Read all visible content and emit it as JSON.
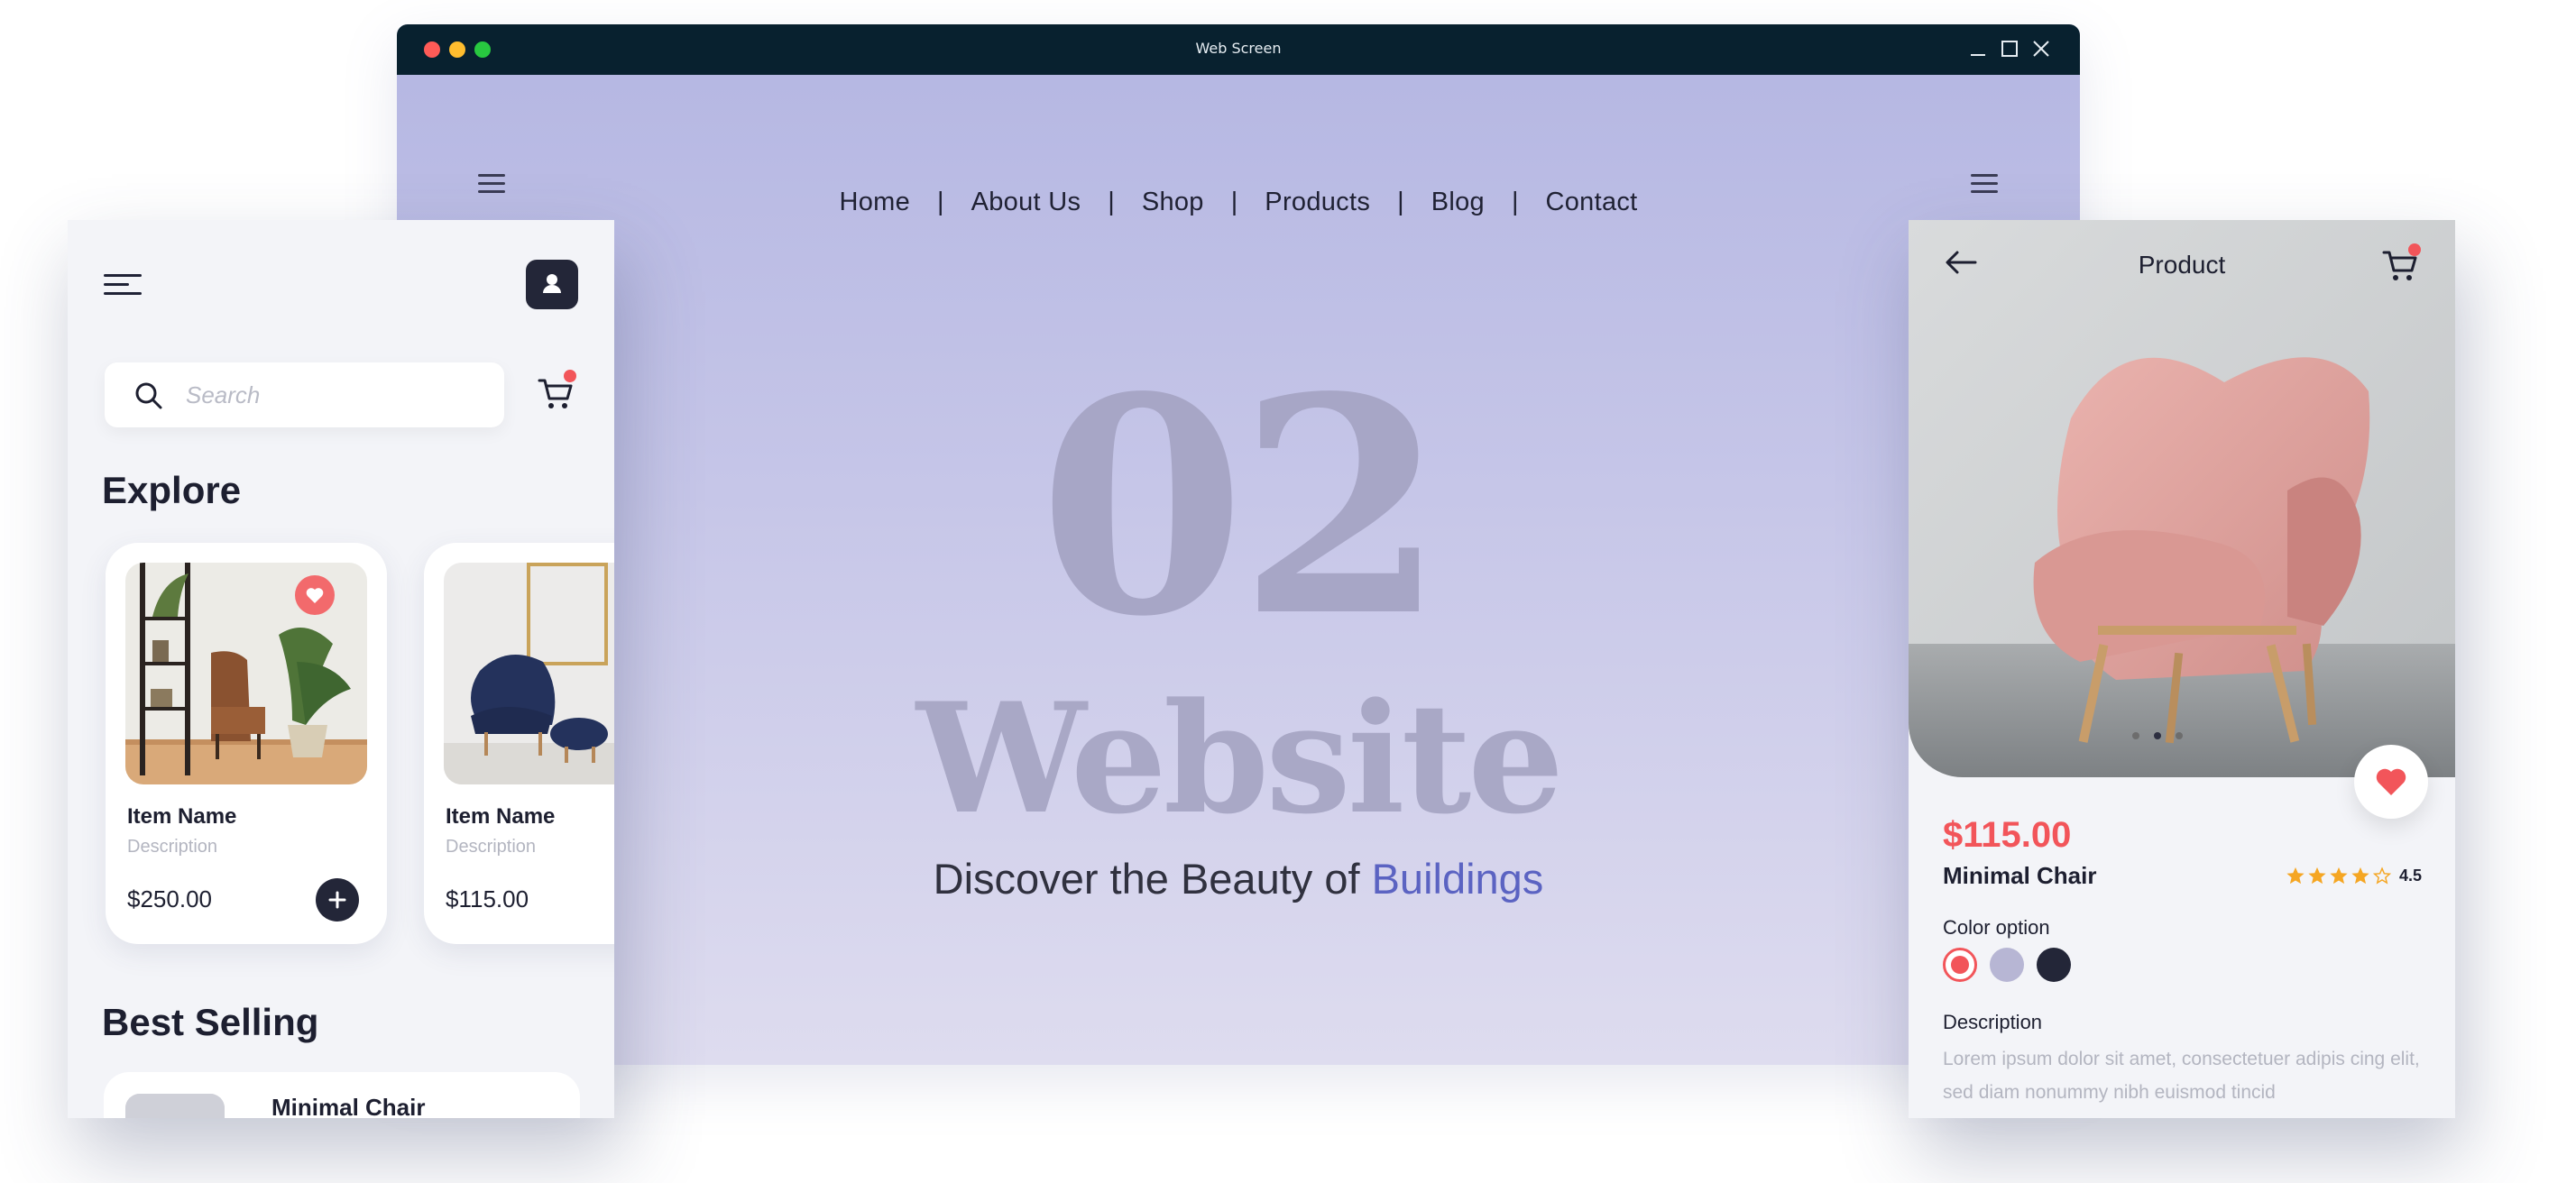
{
  "window": {
    "title": "Web Screen"
  },
  "website": {
    "nav": [
      "Home",
      "About Us",
      "Shop",
      "Products",
      "Blog",
      "Contact"
    ],
    "separator": "|",
    "hero_number": "02",
    "hero_word": "Website",
    "tagline_prefix": "Discover the Beauty of ",
    "tagline_accent": "Buildings"
  },
  "left_app": {
    "search_placeholder": "Search",
    "explore_heading": "Explore",
    "cards": [
      {
        "name": "Item Name",
        "description": "Description",
        "price": "$250.00"
      },
      {
        "name": "Item Name",
        "description": "Description",
        "price": "$115.00"
      }
    ],
    "best_selling_heading": "Best Selling",
    "best_selling_item": "Minimal Chair"
  },
  "right_app": {
    "title": "Product",
    "price": "$115.00",
    "name": "Minimal Chair",
    "rating": "4.5",
    "stars_filled": 4,
    "stars_total": 5,
    "color_heading": "Color option",
    "colors": [
      "#f2555a",
      "#b7b6d4",
      "#232638"
    ],
    "description_heading": "Description",
    "description": "Lorem ipsum dolor sit amet, consectetuer adipis cing elit, sed diam nonummy nibh euismod tincid"
  },
  "colors": {
    "titlebar": "#08212f",
    "accent": "#5b63c2",
    "price_red": "#f2555a",
    "dark": "#232638"
  }
}
